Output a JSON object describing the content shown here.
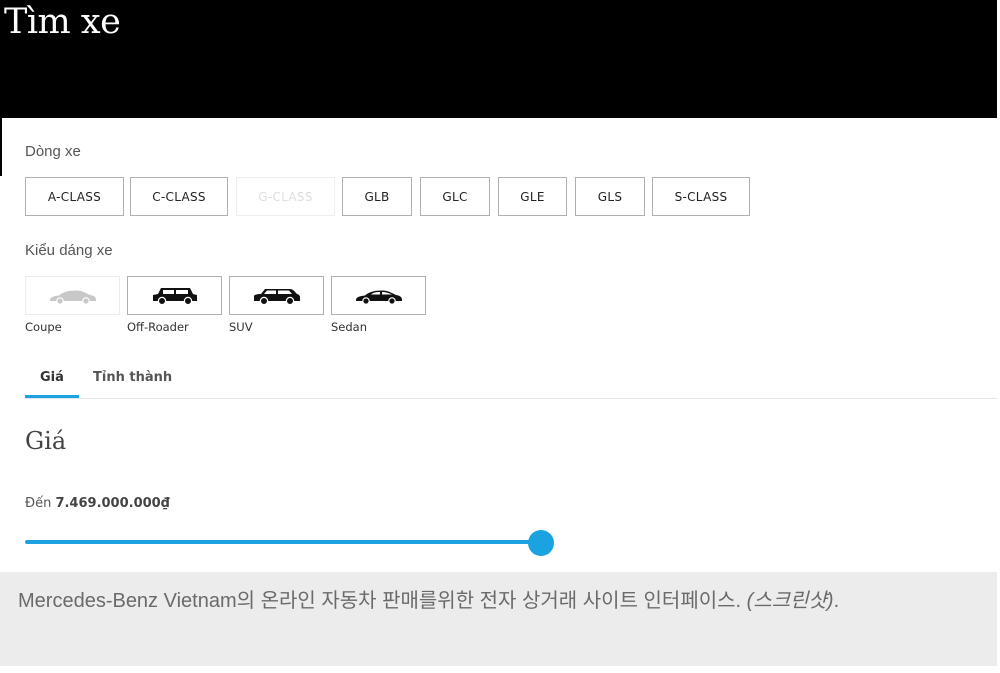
{
  "header": {
    "title": "Tìm xe"
  },
  "model_section": {
    "label": "Dòng xe",
    "models": [
      {
        "label": "A-CLASS",
        "enabled": true
      },
      {
        "label": "C-CLASS",
        "enabled": true
      },
      {
        "label": "G-CLASS",
        "enabled": false
      },
      {
        "label": "GLB",
        "enabled": true
      },
      {
        "label": "GLC",
        "enabled": true
      },
      {
        "label": "GLE",
        "enabled": true
      },
      {
        "label": "GLS",
        "enabled": true
      },
      {
        "label": "S-CLASS",
        "enabled": true
      }
    ]
  },
  "body_section": {
    "label": "Kiểu dáng xe",
    "types": [
      {
        "label": "Coupe",
        "icon": "coupe-car-icon",
        "enabled": false
      },
      {
        "label": "Off-Roader",
        "icon": "off-roader-car-icon",
        "enabled": true
      },
      {
        "label": "SUV",
        "icon": "suv-car-icon",
        "enabled": true
      },
      {
        "label": "Sedan",
        "icon": "sedan-car-icon",
        "enabled": true
      }
    ]
  },
  "tabs": [
    {
      "label": "Giá",
      "active": true
    },
    {
      "label": "Tỉnh thành",
      "active": false
    }
  ],
  "price": {
    "heading": "Giá",
    "prefix": "Đến",
    "max_value": "7.469.000.000₫",
    "slider_level": 1.0
  },
  "caption": {
    "text": "Mercedes-Benz Vietnam의 온라인 자동차 판매를위한 전자 상거래 사이트 인터페이스.",
    "note": "(스크린샷)",
    "end": "."
  },
  "colors": {
    "accent": "#1aa3e0",
    "header_bg": "#000000",
    "caption_bg": "#ececec"
  }
}
